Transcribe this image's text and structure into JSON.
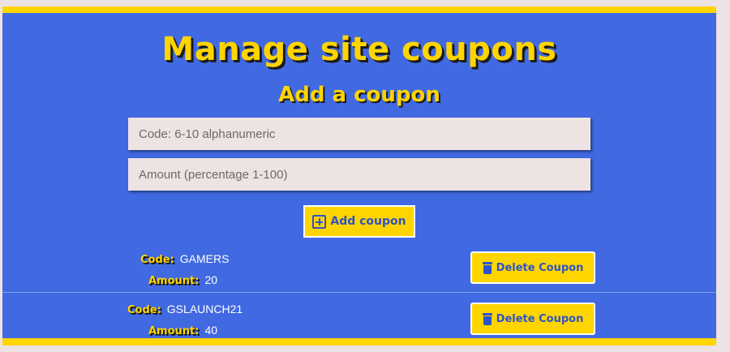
{
  "page": {
    "title": "Manage site coupons",
    "subtitle": "Add a coupon"
  },
  "form": {
    "code_placeholder": "Code: 6-10 alphanumeric",
    "code_value": "",
    "amount_placeholder": "Amount (percentage 1-100)",
    "amount_value": "",
    "add_button_label": "Add coupon",
    "add_button_icon": "plus-square-icon"
  },
  "coupons": [
    {
      "code_label": "Code:",
      "code": "GAMERS",
      "amount_label": "Amount:",
      "amount": "20",
      "delete_label": "Delete Coupon",
      "delete_icon": "trash-icon"
    },
    {
      "code_label": "Code:",
      "code": "GSLAUNCH21",
      "amount_label": "Amount:",
      "amount": "40",
      "delete_label": "Delete Coupon",
      "delete_icon": "trash-icon"
    }
  ],
  "colors": {
    "page_background": "#ede3e3",
    "panel_background": "#4169e1",
    "accent_yellow": "#ffd500",
    "button_text_blue": "#2f52c8"
  }
}
